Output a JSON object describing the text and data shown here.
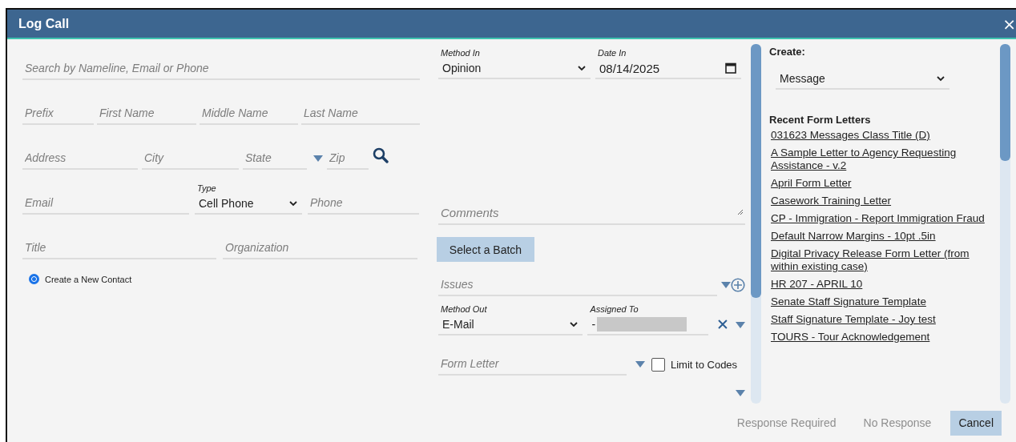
{
  "window": {
    "title": "Log Call",
    "close": "×"
  },
  "contact": {
    "rows": [
      {
        "fields": [
          {
            "kind": "input",
            "placeholder": "Search by Nameline, Email or Phone"
          }
        ]
      },
      {
        "fields": [
          {
            "kind": "input",
            "placeholder": "Prefix"
          },
          {
            "kind": "input",
            "placeholder": "First Name"
          },
          {
            "kind": "input",
            "placeholder": "Middle Name"
          },
          {
            "kind": "input",
            "placeholder": "Last Name"
          }
        ]
      },
      {
        "fields": [
          {
            "kind": "input",
            "placeholder": "Address"
          },
          {
            "kind": "input",
            "placeholder": "City"
          },
          {
            "kind": "combo",
            "placeholder": "State"
          },
          {
            "kind": "input",
            "placeholder": "Zip"
          },
          {
            "kind": "lookup"
          }
        ]
      },
      {
        "fields": [
          {
            "kind": "input",
            "placeholder": "Email"
          },
          {
            "kind": "select",
            "label": "Type",
            "value": "Cell Phone"
          },
          {
            "kind": "input",
            "placeholder": "Phone"
          }
        ]
      },
      {
        "fields": [
          {
            "kind": "input",
            "placeholder": "Title"
          },
          {
            "kind": "input",
            "placeholder": "Organization"
          }
        ]
      }
    ],
    "radio": {
      "label": "Create a New Contact",
      "selected": true
    }
  },
  "call": {
    "method_in": {
      "label": "Method In",
      "value": "Opinion"
    },
    "date_in": {
      "label": "Date In",
      "value": "08/14/2025"
    },
    "comments": {
      "placeholder": "Comments"
    },
    "batch_button": "Select a Batch",
    "issues": {
      "placeholder": "Issues"
    },
    "method_out": {
      "label": "Method Out",
      "value": "E-Mail"
    },
    "assigned_to": {
      "label": "Assigned To",
      "value": "-"
    },
    "form_letter": {
      "placeholder": "Form Letter"
    },
    "limit_to_codes": {
      "label": "Limit to Codes",
      "checked": false
    }
  },
  "create": {
    "label": "Create:",
    "value": "Message",
    "recent_title": "Recent Form Letters",
    "letters": [
      "031623 Messages Class Title (D)",
      "A Sample Letter to Agency Requesting Assistance - v.2",
      "April Form Letter",
      "Casework Training Letter",
      "CP - Immigration - Report Immigration Fraud",
      "Default Narrow Margins - 10pt .5in",
      "Digital Privacy Release Form Letter (from within existing case)",
      "HR 207 - APRIL 10",
      "Senate Staff Signature Template",
      "Staff Signature Template - Joy test",
      "TOURS - Tour Acknowledgement"
    ]
  },
  "footer": {
    "buttons": [
      {
        "label": "Response Required",
        "disabled": true
      },
      {
        "label": "No Response",
        "disabled": true
      },
      {
        "label": "Cancel",
        "disabled": false
      }
    ]
  }
}
